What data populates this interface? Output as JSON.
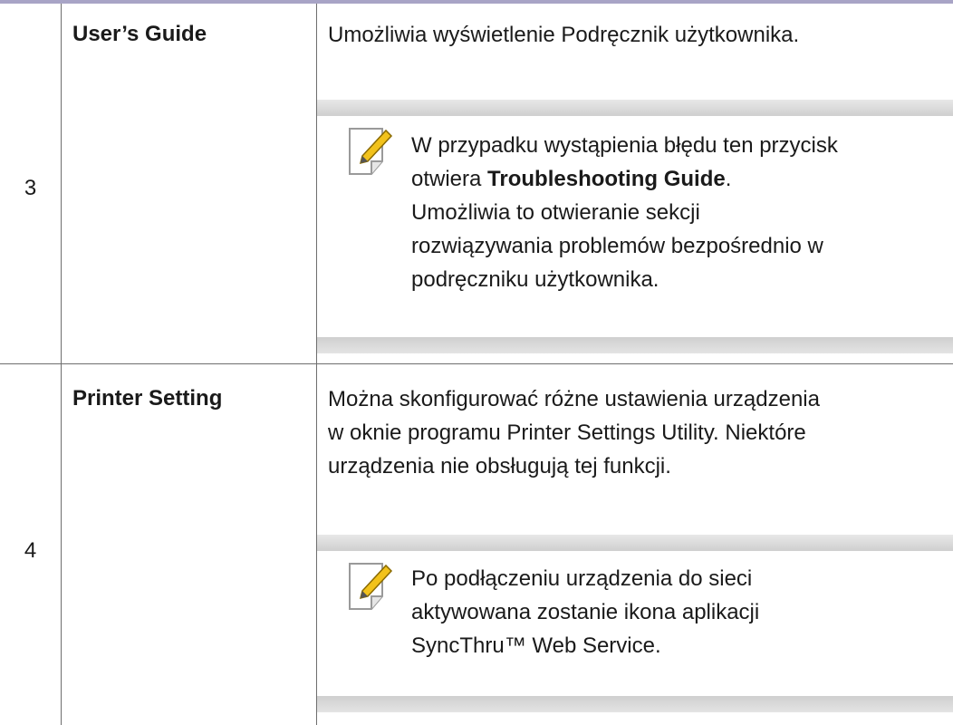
{
  "rows": [
    {
      "number": "3",
      "name": "User’s Guide",
      "description": "Umożliwia wyświetlenie Podręcznik użytkownika.",
      "note": {
        "icon": "note-pencil-icon",
        "line1": "W przypadku wystąpienia błędu ten przycisk",
        "line2_prefix": "otwiera ",
        "line2_bold": "Troubleshooting Guide",
        "line2_suffix": ".",
        "line3": "Umożliwia to otwieranie sekcji",
        "line4": "rozwiązywania problemów bezpośrednio w",
        "line5": "podręczniku użytkownika."
      }
    },
    {
      "number": "4",
      "name": "Printer Setting",
      "description_line1": "Można skonfigurować różne ustawienia urządzenia",
      "description_line2": "w oknie programu Printer Settings Utility. Niektóre",
      "description_line3": "urządzenia nie obsługują tej funkcji.",
      "note": {
        "icon": "note-pencil-icon",
        "line1": "Po podłączeniu urządzenia do sieci",
        "line2": "aktywowana zostanie ikona aplikacji",
        "line3": "SyncThru™ Web Service."
      }
    }
  ]
}
